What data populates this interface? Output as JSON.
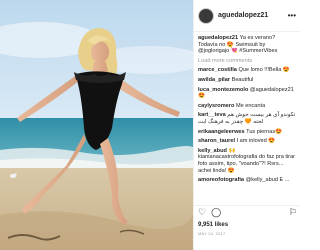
{
  "post": {
    "username": "aguedalopez21",
    "caption_user": "aguedalopez21",
    "caption_text": "Ya es verano? Todavía no 😍 Swimsuit by @joglorigajo 💘 #SummerVibes",
    "load_more": "Load more comments",
    "comments": [
      {
        "user": "marce_costilla",
        "text": "Que lomo !!!Bella 😍"
      },
      {
        "user": "awilda_pilar",
        "text": "Beautiful"
      },
      {
        "user": "luca_montezemolo",
        "text": "@aguedalopez21 😍"
      },
      {
        "user": "caylysromero",
        "text": "Me encanta"
      },
      {
        "user": "kart__teva",
        "text": "تکوندو آی هر بیست حوش هم لحته 🧡 چقدر به فرهنگ ایت"
      },
      {
        "user": "erikaangeleerwes",
        "text": "Tus piernas😍"
      },
      {
        "user": "sharon_taurel",
        "text": "I am inloved 😍"
      },
      {
        "user": "kelly_abud",
        "text": "🙌 kianianacastrofotografia do faz pra tirar foto assim, tipo, \"voando\"?! Rsrs... achei linda! 😍"
      },
      {
        "user": "amoreofotografia",
        "text": "@kelly_abud E ..."
      }
    ],
    "likes": "9,951 likes",
    "date": "MAY 24, 2017"
  },
  "icons": {
    "more": "more-horizontal-icon",
    "like": "heart-icon",
    "comment": "comment-icon",
    "save": "bookmark-icon"
  },
  "colors": {
    "link": "#003569",
    "muted": "#999999",
    "border": "#efefef"
  }
}
